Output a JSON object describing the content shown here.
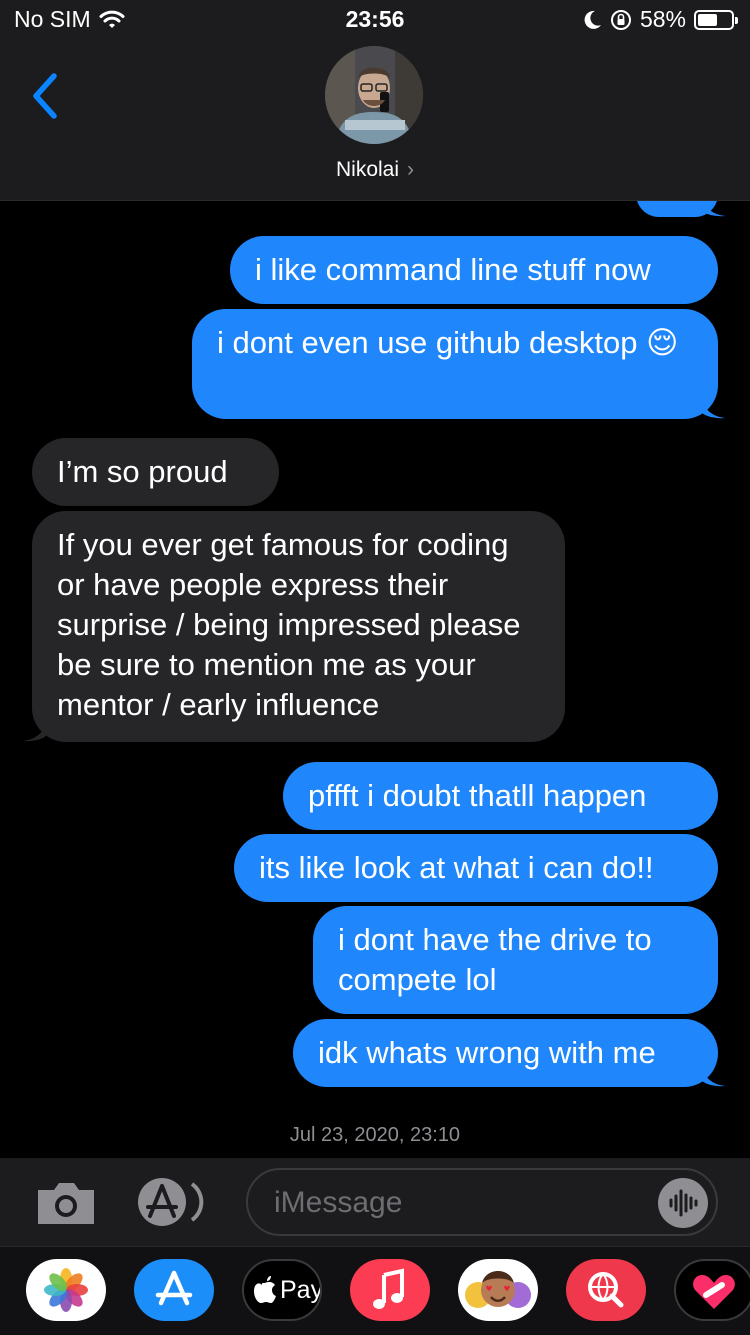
{
  "status_bar": {
    "carrier": "No SIM",
    "time": "23:56",
    "battery_percent": "58%",
    "battery_level": 0.58,
    "icons": [
      "wifi-icon",
      "moon-icon",
      "orientation-lock-icon",
      "battery-icon"
    ]
  },
  "header": {
    "contact_name": "Nikolai",
    "chevron": "›",
    "back_icon": "chevron-left-icon",
    "accent_color": "#0a84ff"
  },
  "messages": [
    {
      "direction": "sent",
      "text": "i like command line stuff now"
    },
    {
      "direction": "sent",
      "text": "i dont even use github desktop 😌"
    },
    {
      "direction": "received",
      "text": "I’m so proud"
    },
    {
      "direction": "received",
      "text": "If you ever get famous for coding or have people express their surprise / being impressed please be sure to mention me as your mentor / early influence"
    },
    {
      "direction": "sent",
      "text": "pffft i doubt thatll happen"
    },
    {
      "direction": "sent",
      "text": "its like look at what i can do!!"
    },
    {
      "direction": "sent",
      "text": "i dont have the drive to compete lol"
    },
    {
      "direction": "sent",
      "text": "idk whats wrong with me"
    }
  ],
  "timestamp": "Jul 23, 2020, 23:10",
  "input_bar": {
    "placeholder": "iMessage",
    "camera_icon": "camera-icon",
    "apps_icon": "app-store-icon",
    "audio_icon": "audio-waveform-icon"
  },
  "app_drawer": {
    "apps": [
      {
        "name": "photos-app-icon",
        "label": ""
      },
      {
        "name": "app-store-app-icon",
        "label": ""
      },
      {
        "name": "apple-pay-app-icon",
        "label": "Pay"
      },
      {
        "name": "music-app-icon",
        "label": ""
      },
      {
        "name": "memoji-app-icon",
        "label": ""
      },
      {
        "name": "web-search-app-icon",
        "label": ""
      },
      {
        "name": "digital-touch-app-icon",
        "label": ""
      }
    ]
  },
  "colors": {
    "sent_bubble": "#1f87fb",
    "received_bubble": "#262628",
    "background": "#000000",
    "bar_background": "#1c1c1e"
  }
}
